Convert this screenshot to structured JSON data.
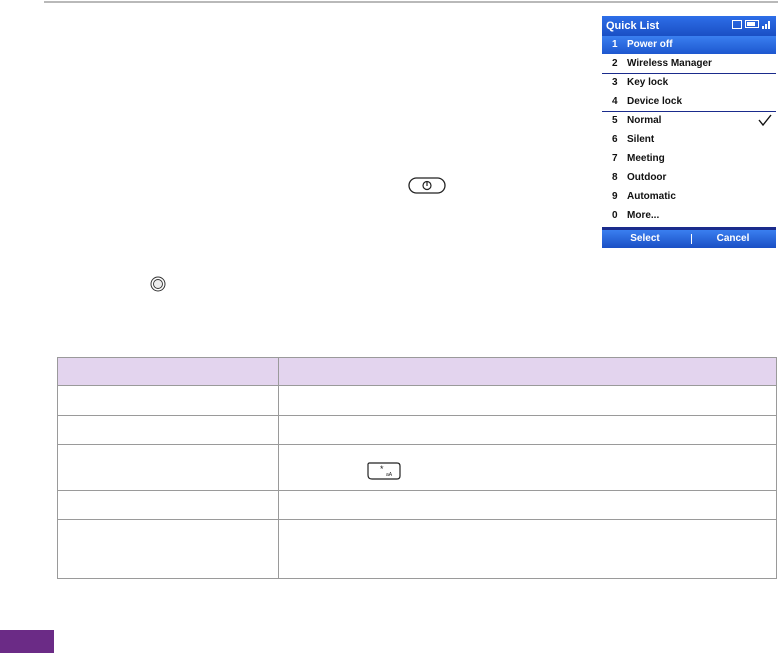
{
  "phone": {
    "title": "Quick List",
    "items": [
      {
        "num": "1",
        "label": "Power off"
      },
      {
        "num": "2",
        "label": "Wireless Manager"
      },
      {
        "num": "3",
        "label": "Key lock"
      },
      {
        "num": "4",
        "label": "Device lock"
      },
      {
        "num": "5",
        "label": "Normal"
      },
      {
        "num": "6",
        "label": "Silent"
      },
      {
        "num": "7",
        "label": "Meeting"
      },
      {
        "num": "8",
        "label": "Outdoor"
      },
      {
        "num": "9",
        "label": "Automatic"
      },
      {
        "num": "0",
        "label": "More..."
      }
    ],
    "softkey_left": "Select",
    "softkey_right": "Cancel",
    "icons": [
      "message-icon",
      "battery-icon",
      "signal-icon",
      "checkmark-icon"
    ]
  },
  "key_icons": [
    "power-key-icon",
    "center-key-icon",
    "star-key-icon"
  ],
  "star_key_label": "*",
  "colors": {
    "table_header": "#e3d4ee",
    "page_tab": "#6b2b86",
    "phone_highlight": "#2d6ee8"
  }
}
